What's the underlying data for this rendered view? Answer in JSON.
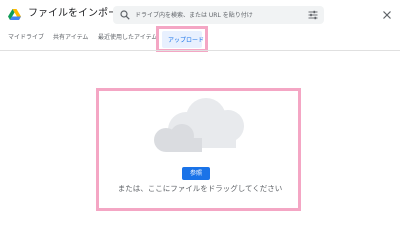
{
  "dialog": {
    "title": "ファイルをインポート",
    "close_icon": "close-icon",
    "logo_icon": "google-drive-icon"
  },
  "search": {
    "placeholder": "ドライブ内を検索、または URL を貼り付け",
    "search_icon": "search-icon",
    "filter_icon": "filter-sliders-icon"
  },
  "tabs": [
    {
      "label": "マイドライブ",
      "active": false
    },
    {
      "label": "共有アイテム",
      "active": false
    },
    {
      "label": "最近使用したアイテム",
      "active": false
    },
    {
      "label": "アップロード",
      "active": true
    }
  ],
  "upload": {
    "browse_label": "参照",
    "drag_text": "または、ここにファイルをドラッグしてください",
    "illustration": "cloud-illustration"
  },
  "colors": {
    "accent": "#1a73e8",
    "highlight_frame": "#f4a6c4",
    "active_tab_bg": "#e8f0fe",
    "cloud_gray": "#e0e0e0"
  }
}
